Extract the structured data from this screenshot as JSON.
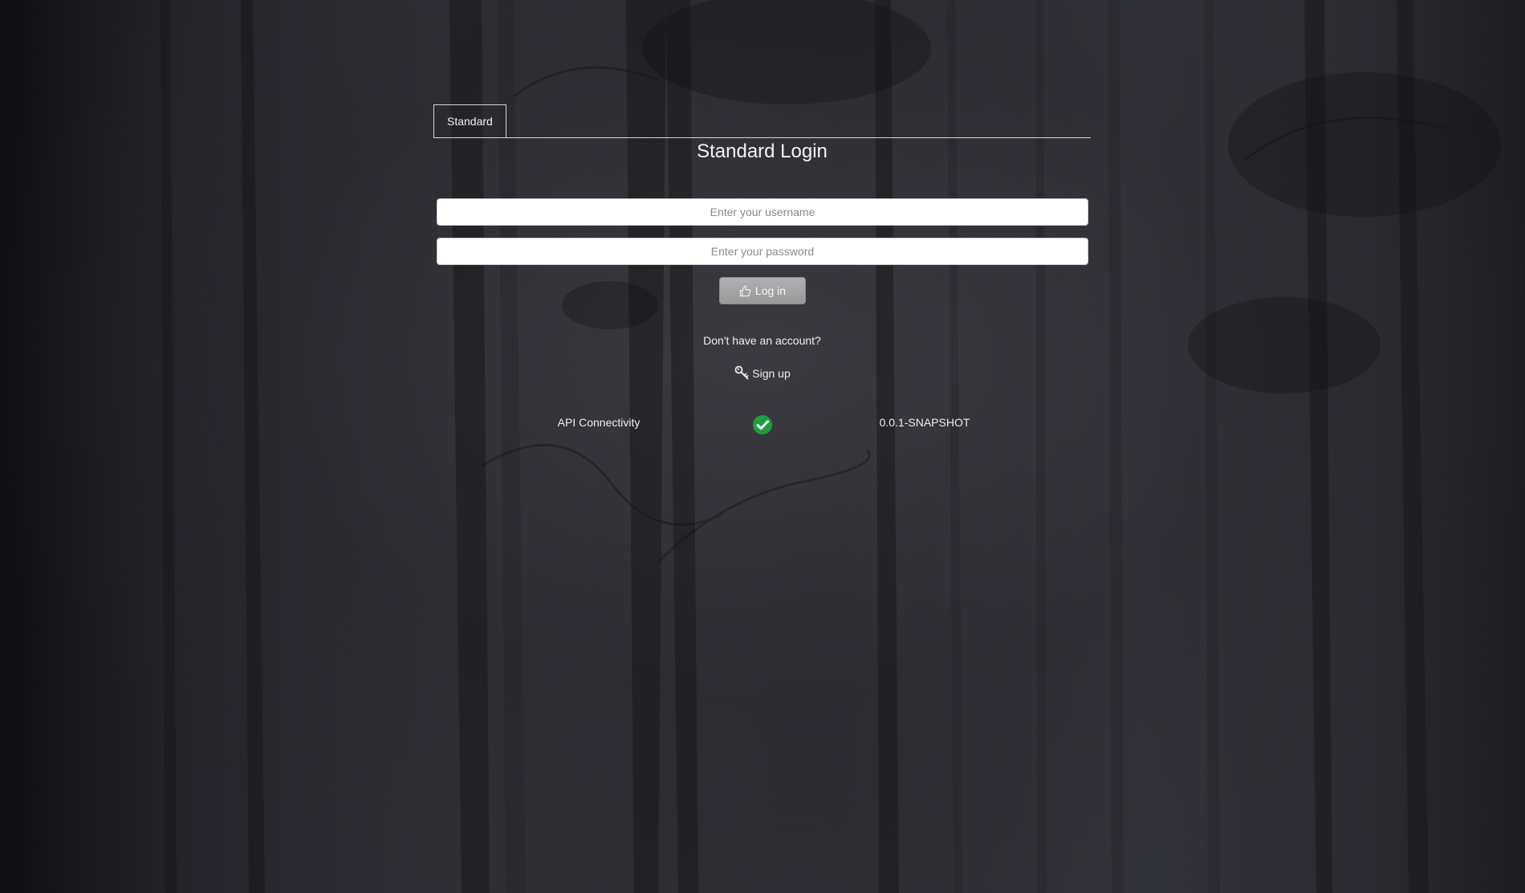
{
  "tabs": [
    {
      "label": "Standard"
    }
  ],
  "login": {
    "title": "Standard Login",
    "username_placeholder": "Enter your username",
    "password_placeholder": "Enter your password",
    "login_label": "Log in",
    "login_icon": "thumbs-up-icon"
  },
  "signup": {
    "prompt": "Don't have an account?",
    "label": "Sign up",
    "icon": "key-icon"
  },
  "status": {
    "label": "API Connectivity",
    "icon": "check-circle-icon",
    "icon_color": "#1e9e3c",
    "version": "0.0.1-SNAPSHOT"
  },
  "colors": {
    "button_bg": "#a5a5a7",
    "text": "#f0f0f0"
  }
}
